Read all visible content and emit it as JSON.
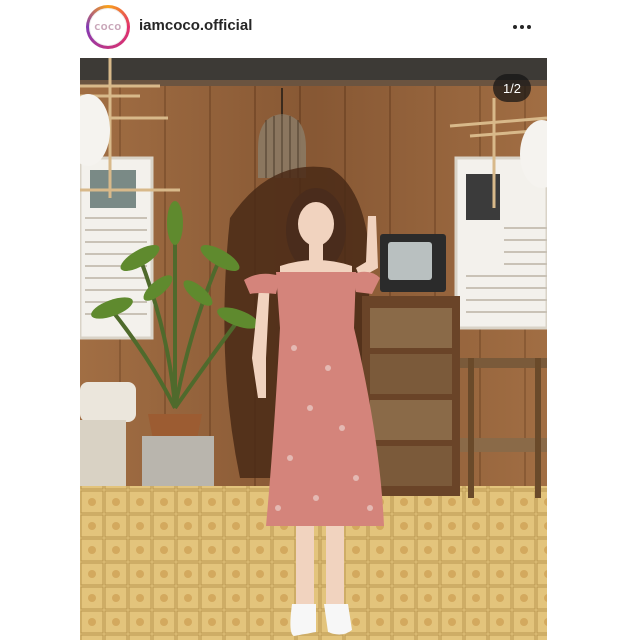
{
  "post": {
    "username": "iamcoco.official",
    "avatar_logo_text": "COCO",
    "menu_icon": "more-horizontal-icon",
    "image_counter": "1/2"
  }
}
